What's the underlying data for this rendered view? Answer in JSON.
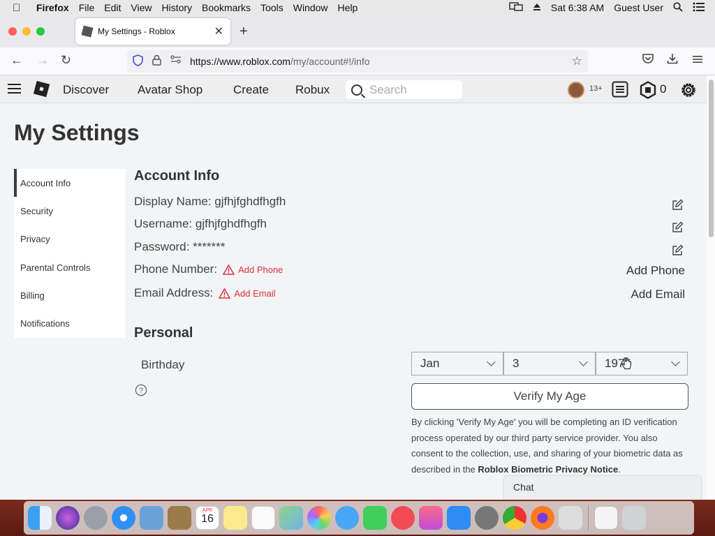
{
  "menubar": {
    "app_name": "Firefox",
    "items": [
      "File",
      "Edit",
      "View",
      "History",
      "Bookmarks",
      "Tools",
      "Window",
      "Help"
    ],
    "clock": "Sat 6:38 AM",
    "user": "Guest User"
  },
  "browser": {
    "tab_title": "My Settings - Roblox",
    "url_host": "https://www.roblox.com",
    "url_path": "/my/account#!/info"
  },
  "roblox_nav": {
    "links": [
      "Discover",
      "Avatar Shop",
      "Create",
      "Robux"
    ],
    "search_placeholder": "Search",
    "age_badge": "13+",
    "robux_count": "0"
  },
  "page": {
    "title": "My Settings",
    "sidebar": [
      "Account Info",
      "Security",
      "Privacy",
      "Parental Controls",
      "Billing",
      "Notifications"
    ],
    "active_sidebar": "Account Info"
  },
  "account_info": {
    "heading": "Account Info",
    "display_name_label": "Display Name: gjfhjfghdfhgfh",
    "username_label": "Username: gjfhjfghdfhgfh",
    "password_label": "Password: *******",
    "phone_label": "Phone Number:",
    "phone_warning": "Add Phone",
    "phone_action": "Add Phone",
    "email_label": "Email Address:",
    "email_warning": "Add Email",
    "email_action": "Add Email"
  },
  "personal": {
    "heading": "Personal",
    "birthday_label": "Birthday",
    "month": "Jan",
    "day": "3",
    "year": "1975",
    "verify_button": "Verify My Age",
    "disclaimer_text": "By clicking 'Verify My Age' you will be completing an ID verification process operated by our third party service provider. You also consent to the collection, use, and sharing of your biometric data as described in the ",
    "disclaimer_link": "Roblox Biometric Privacy Notice",
    "disclaimer_end": "."
  },
  "chat": {
    "label": "Chat"
  },
  "dock": {
    "calendar_month": "APR",
    "calendar_day": "16"
  },
  "colors": {
    "warning_red": "#d8333f",
    "page_bg": "#f2f4f5",
    "nav_bg": "#eeeeee"
  }
}
